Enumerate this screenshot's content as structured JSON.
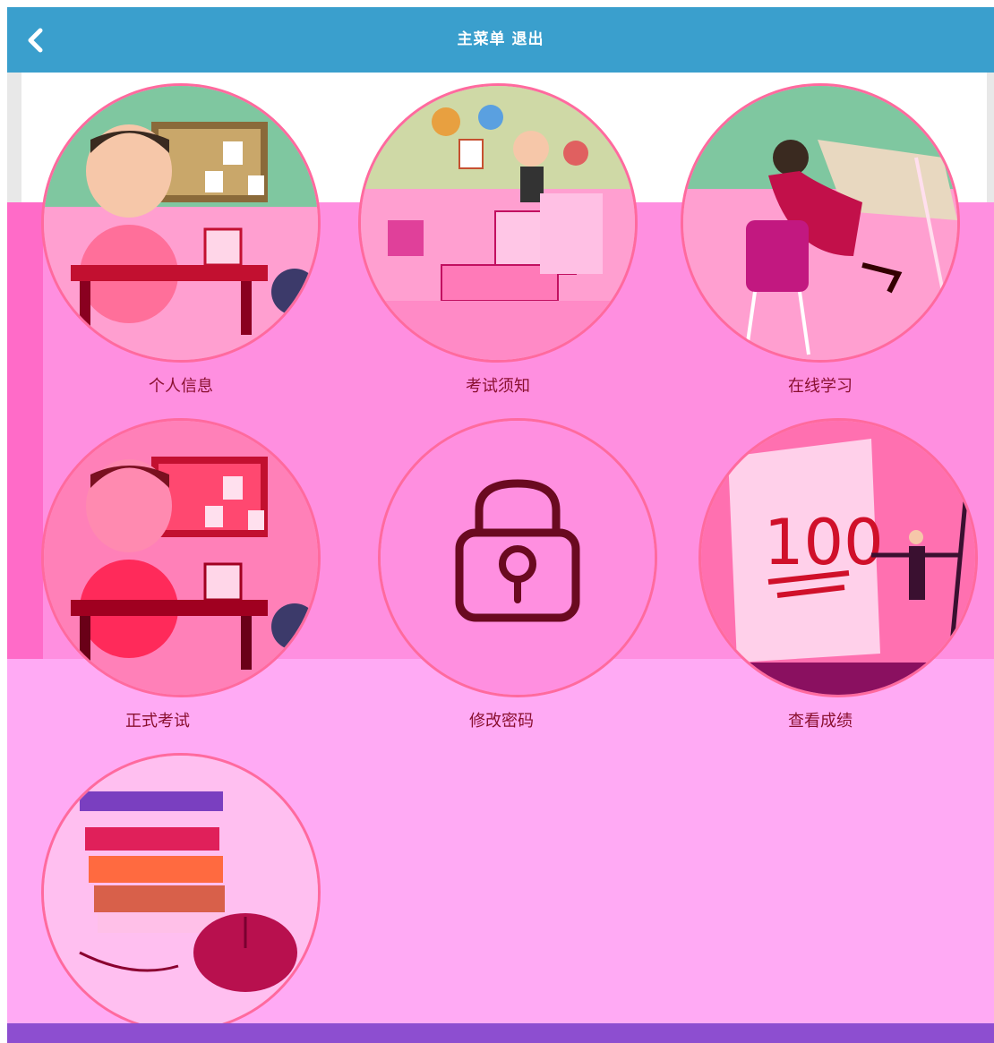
{
  "header": {
    "title_main": "主菜单",
    "title_logout": "退出",
    "back_icon": "chevron-left-icon"
  },
  "menu": [
    {
      "label": "个人信息",
      "icon": "boy-at-desk-illustration"
    },
    {
      "label": "考试须知",
      "icon": "office-presentation-illustration"
    },
    {
      "label": "在线学习",
      "icon": "girl-studying-illustration"
    },
    {
      "label": "正式考试",
      "icon": "boy-at-desk-illustration"
    },
    {
      "label": "修改密码",
      "icon": "padlock-icon"
    },
    {
      "label": "查看成绩",
      "icon": "score-100-illustration"
    },
    {
      "label": "",
      "icon": "books-and-mouse-illustration"
    }
  ],
  "colors": {
    "header": "#3a9fcd",
    "content_bg": "#ffaaf4",
    "circle_border": "#ff6a9e",
    "label_text": "#8a1030",
    "footer": "#8d4ed0"
  }
}
